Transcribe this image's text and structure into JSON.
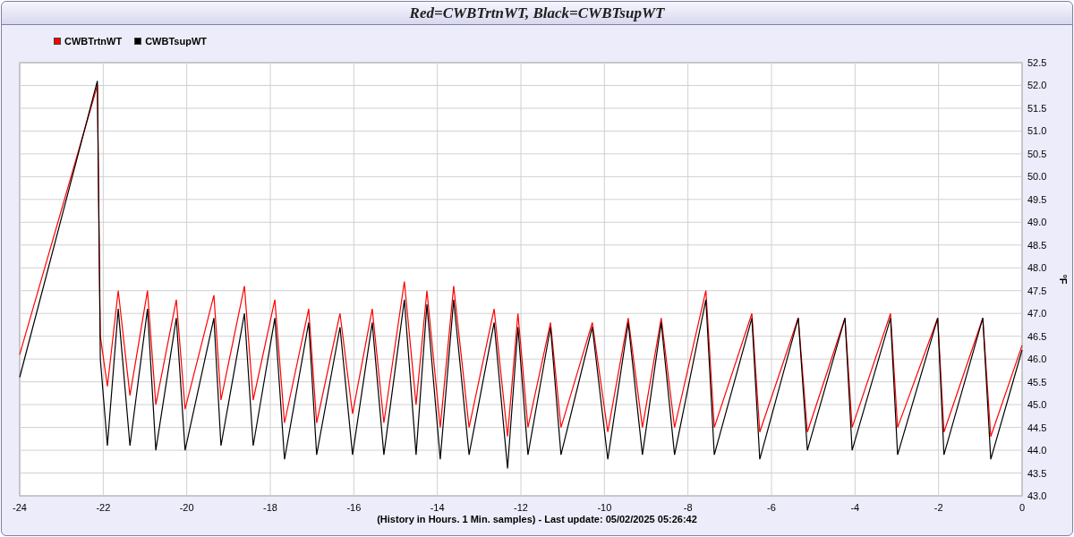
{
  "chart_data": {
    "type": "line",
    "title": "Red=CWBTrtnWT, Black=CWBTsupWT",
    "xlabel": "(History in Hours. 1 Min. samples) - Last update: 05/02/2025 05:26:42",
    "ylabel": "°F",
    "x": [
      -24,
      -22.14,
      -22.07,
      -21.9,
      -21.64,
      -21.36,
      -20.94,
      -20.74,
      -20.25,
      -20.04,
      -19.35,
      -19.18,
      -18.62,
      -18.41,
      -17.89,
      -17.66,
      -17.08,
      -16.89,
      -16.33,
      -16.03,
      -15.56,
      -15.28,
      -14.79,
      -14.51,
      -14.25,
      -13.93,
      -13.61,
      -13.24,
      -12.64,
      -12.32,
      -12.07,
      -11.83,
      -11.29,
      -11.04,
      -10.29,
      -9.92,
      -9.43,
      -9.09,
      -8.64,
      -8.32,
      -7.57,
      -7.37,
      -6.47,
      -6.28,
      -5.36,
      -5.14,
      -4.24,
      -4.07,
      -3.15,
      -2.98,
      -2.02,
      -1.87,
      -0.94,
      -0.75,
      0
    ],
    "series": [
      {
        "name": "CWBTrtnWT",
        "color": "#ff0000",
        "values": [
          46.1,
          52.0,
          46.5,
          45.4,
          47.5,
          45.2,
          47.5,
          45.0,
          47.3,
          44.9,
          47.4,
          45.1,
          47.6,
          45.1,
          47.3,
          44.6,
          47.1,
          44.6,
          47.0,
          44.8,
          47.1,
          44.6,
          47.7,
          45.0,
          47.5,
          44.5,
          47.6,
          44.5,
          47.1,
          44.3,
          47.0,
          44.5,
          46.8,
          44.5,
          46.8,
          44.4,
          46.9,
          44.5,
          46.9,
          44.5,
          47.5,
          44.5,
          47.0,
          44.4,
          46.9,
          44.4,
          46.9,
          44.5,
          47.0,
          44.5,
          46.9,
          44.4,
          46.9,
          44.3,
          46.3
        ]
      },
      {
        "name": "CWBTsupWT",
        "color": "#000000",
        "values": [
          45.6,
          52.1,
          46.0,
          44.1,
          47.1,
          44.1,
          47.1,
          44.0,
          46.9,
          44.0,
          46.9,
          44.1,
          47.0,
          44.1,
          46.9,
          43.8,
          46.8,
          43.9,
          46.7,
          43.9,
          46.8,
          43.9,
          47.3,
          43.9,
          47.2,
          43.8,
          47.3,
          43.9,
          46.8,
          43.6,
          46.7,
          43.9,
          46.7,
          43.9,
          46.7,
          43.8,
          46.8,
          43.9,
          46.8,
          43.9,
          47.3,
          43.9,
          46.9,
          43.8,
          46.9,
          44.0,
          46.9,
          44.0,
          46.9,
          43.9,
          46.9,
          43.9,
          46.9,
          43.8,
          46.2
        ]
      }
    ],
    "grid": true,
    "legend": true,
    "xlim": [
      -24,
      0
    ],
    "ylim": [
      43,
      52.5
    ],
    "xticks": [
      -24,
      -22,
      -20,
      -18,
      -16,
      -14,
      -12,
      -10,
      -8,
      -6,
      -4,
      -2,
      0
    ],
    "yticks": [
      {
        "value": 43,
        "label": "43.0"
      },
      {
        "value": 43.5,
        "label": "43.5"
      },
      {
        "value": 44,
        "label": "44.0"
      },
      {
        "value": 44.5,
        "label": "44.5"
      },
      {
        "value": 45,
        "label": "45.0"
      },
      {
        "value": 45.5,
        "label": "45.5"
      },
      {
        "value": 46,
        "label": "46.0"
      },
      {
        "value": 46.5,
        "label": "46.5"
      },
      {
        "value": 47,
        "label": "47.0"
      },
      {
        "value": 47.5,
        "label": "47.5"
      },
      {
        "value": 48,
        "label": "48.0"
      },
      {
        "value": 48.5,
        "label": "48.5"
      },
      {
        "value": 49,
        "label": "49.0"
      },
      {
        "value": 49.5,
        "label": "49.5"
      },
      {
        "value": 50,
        "label": "50.0"
      },
      {
        "value": 50.5,
        "label": "50.5"
      },
      {
        "value": 51,
        "label": "51.0"
      },
      {
        "value": 51.5,
        "label": "51.5"
      },
      {
        "value": 52,
        "label": "52.0"
      },
      {
        "value": 52.5,
        "label": "52.5"
      }
    ]
  }
}
